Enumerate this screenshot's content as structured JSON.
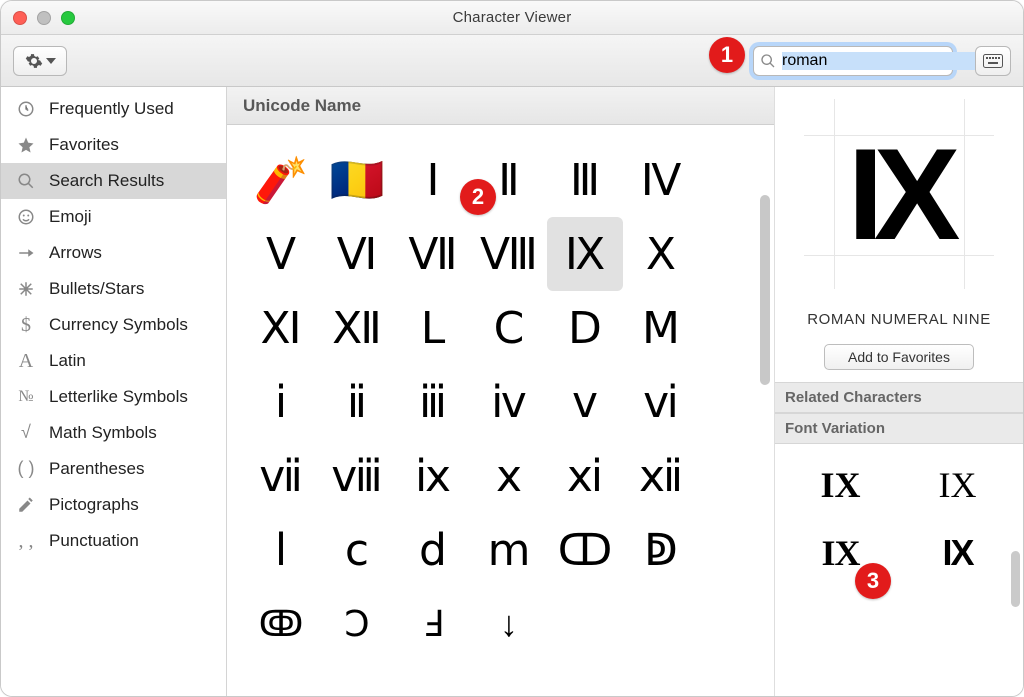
{
  "window": {
    "title": "Character Viewer"
  },
  "search": {
    "value": "roman"
  },
  "sidebar": {
    "items": [
      {
        "icon": "clock-icon",
        "label": "Frequently Used"
      },
      {
        "icon": "star-icon",
        "label": "Favorites"
      },
      {
        "icon": "search-icon",
        "label": "Search Results",
        "selected": true
      },
      {
        "icon": "smiley-icon",
        "label": "Emoji"
      },
      {
        "icon": "arrow-icon",
        "label": "Arrows"
      },
      {
        "icon": "asterisk-icon",
        "label": "Bullets/Stars"
      },
      {
        "icon": "dollar-icon",
        "label": "Currency Symbols"
      },
      {
        "icon": "latin-icon",
        "label": "Latin"
      },
      {
        "icon": "numero-icon",
        "label": "Letterlike Symbols"
      },
      {
        "icon": "radical-icon",
        "label": "Math Symbols"
      },
      {
        "icon": "parens-icon",
        "label": "Parentheses"
      },
      {
        "icon": "pencil-icon",
        "label": "Pictographs"
      },
      {
        "icon": "comma-icon",
        "label": "Punctuation"
      }
    ]
  },
  "results": {
    "header": "Unicode Name",
    "chars": [
      "🧨",
      "🇷🇴",
      "Ⅰ",
      "Ⅱ",
      "Ⅲ",
      "Ⅳ",
      "Ⅴ",
      "Ⅵ",
      "Ⅶ",
      "Ⅷ",
      "Ⅸ",
      "Ⅹ",
      "Ⅺ",
      "Ⅻ",
      "Ⅼ",
      "Ⅽ",
      "Ⅾ",
      "Ⅿ",
      "ⅰ",
      "ⅱ",
      "ⅲ",
      "ⅳ",
      "ⅴ",
      "ⅵ",
      "ⅶ",
      "ⅷ",
      "ⅸ",
      "ⅹ",
      "ⅺ",
      "ⅻ",
      "ⅼ",
      "ⅽ",
      "ⅾ",
      "ⅿ",
      "ↀ",
      "ↁ",
      "ↂ",
      "Ↄ",
      "Ⅎ",
      "↓",
      "",
      ""
    ],
    "selected_index": 10
  },
  "detail": {
    "preview_char": "IX",
    "name": "ROMAN NUMERAL NINE",
    "favorites_button": "Add to Favorites",
    "related_header": "Related Characters",
    "fontvar_header": "Font Variation",
    "variants": [
      "IX",
      "IX",
      "IX",
      "IX"
    ]
  },
  "callouts": {
    "c1": "1",
    "c2": "2",
    "c3": "3"
  }
}
